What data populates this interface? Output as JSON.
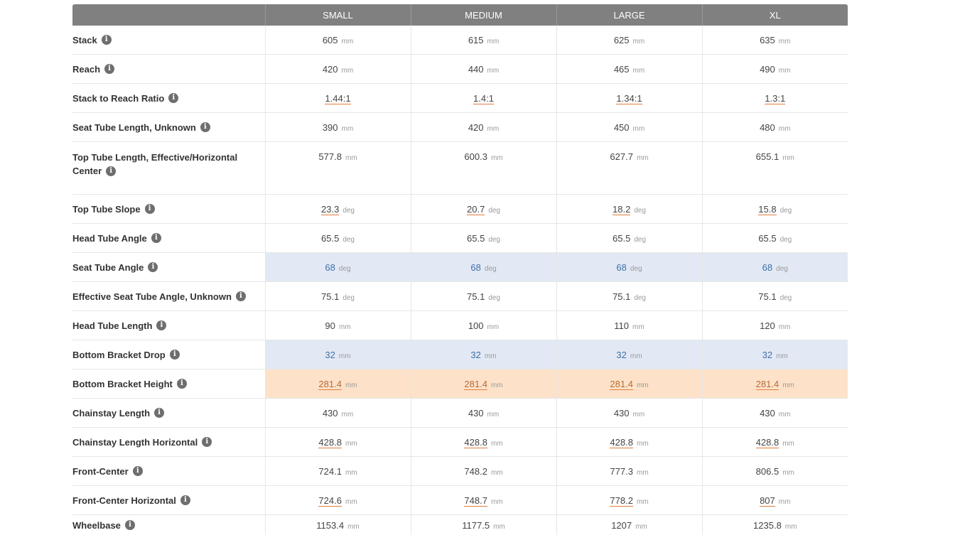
{
  "table": {
    "columns": [
      "SMALL",
      "MEDIUM",
      "LARGE",
      "XL"
    ],
    "rows": [
      {
        "label": "Stack",
        "unit": "mm",
        "values": [
          "605",
          "615",
          "625",
          "635"
        ],
        "calc": false,
        "highlight": ""
      },
      {
        "label": "Reach",
        "unit": "mm",
        "values": [
          "420",
          "440",
          "465",
          "490"
        ],
        "calc": false,
        "highlight": ""
      },
      {
        "label": "Stack to Reach Ratio",
        "unit": "",
        "values": [
          "1.44:1",
          "1.4:1",
          "1.34:1",
          "1.3:1"
        ],
        "calc": true,
        "highlight": ""
      },
      {
        "label": "Seat Tube Length, Unknown",
        "unit": "mm",
        "values": [
          "390",
          "420",
          "450",
          "480"
        ],
        "calc": false,
        "highlight": ""
      },
      {
        "label": "Top Tube Length, Effective/Horizontal Center",
        "unit": "mm",
        "values": [
          "577.8",
          "600.3",
          "627.7",
          "655.1"
        ],
        "calc": false,
        "highlight": "",
        "tall": true
      },
      {
        "label": "Top Tube Slope",
        "unit": "deg",
        "values": [
          "23.3",
          "20.7",
          "18.2",
          "15.8"
        ],
        "calc": true,
        "highlight": ""
      },
      {
        "label": "Head Tube Angle",
        "unit": "deg",
        "values": [
          "65.5",
          "65.5",
          "65.5",
          "65.5"
        ],
        "calc": false,
        "highlight": ""
      },
      {
        "label": "Seat Tube Angle",
        "unit": "deg",
        "values": [
          "68",
          "68",
          "68",
          "68"
        ],
        "calc": false,
        "highlight": "blue"
      },
      {
        "label": "Effective Seat Tube Angle, Unknown",
        "unit": "deg",
        "values": [
          "75.1",
          "75.1",
          "75.1",
          "75.1"
        ],
        "calc": false,
        "highlight": ""
      },
      {
        "label": "Head Tube Length",
        "unit": "mm",
        "values": [
          "90",
          "100",
          "110",
          "120"
        ],
        "calc": false,
        "highlight": ""
      },
      {
        "label": "Bottom Bracket Drop",
        "unit": "mm",
        "values": [
          "32",
          "32",
          "32",
          "32"
        ],
        "calc": false,
        "highlight": "blue"
      },
      {
        "label": "Bottom Bracket Height",
        "unit": "mm",
        "values": [
          "281.4",
          "281.4",
          "281.4",
          "281.4"
        ],
        "calc": true,
        "highlight": "orange"
      },
      {
        "label": "Chainstay Length",
        "unit": "mm",
        "values": [
          "430",
          "430",
          "430",
          "430"
        ],
        "calc": false,
        "highlight": ""
      },
      {
        "label": "Chainstay Length Horizontal",
        "unit": "mm",
        "values": [
          "428.8",
          "428.8",
          "428.8",
          "428.8"
        ],
        "calc": true,
        "highlight": ""
      },
      {
        "label": "Front-Center",
        "unit": "mm",
        "values": [
          "724.1",
          "748.2",
          "777.3",
          "806.5"
        ],
        "calc": false,
        "highlight": ""
      },
      {
        "label": "Front-Center Horizontal",
        "unit": "mm",
        "values": [
          "724.6",
          "748.7",
          "778.2",
          "807"
        ],
        "calc": true,
        "highlight": ""
      },
      {
        "label": "Wheelbase",
        "unit": "mm",
        "values": [
          "1153.4",
          "1177.5",
          "1207",
          "1235.8"
        ],
        "calc": false,
        "highlight": "",
        "last": true
      }
    ]
  },
  "icons": {
    "info": "info-icon",
    "info_glyph": "i"
  },
  "colors": {
    "header_bg": "#808080",
    "highlight_blue": "#e2e9f5",
    "highlight_orange": "#fde2c9",
    "calc_underline": "#e07c3e"
  }
}
